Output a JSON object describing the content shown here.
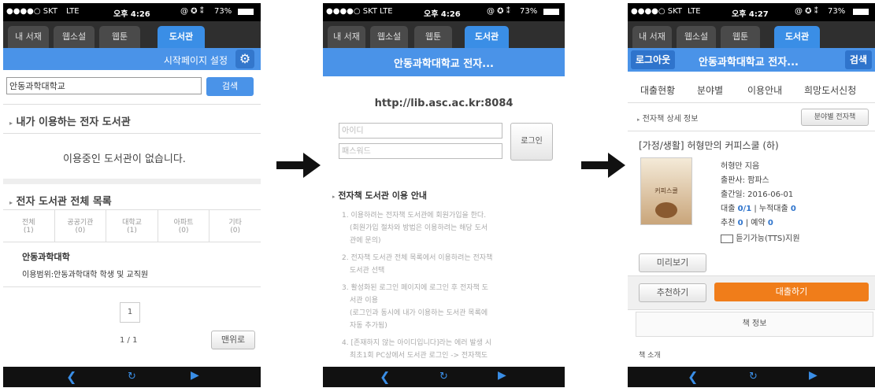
{
  "status": {
    "carrier": "●●●●○ SKT",
    "network": "LTE",
    "time1": "오후 4:26",
    "time2": "오후 4:26",
    "time3": "오후 4:27",
    "icons": "@ ✪ ⁑",
    "battery": "73%"
  },
  "tabs": [
    "내 서재",
    "웹소설",
    "웹툰",
    "도서관"
  ],
  "screen1": {
    "settings_label": "시작페이지 설정",
    "search_value": "안동과학대학교",
    "search_button": "검색",
    "my_library_heading": "내가 이용하는 전자 도서관",
    "empty_message": "이용중인 도서관이 없습니다.",
    "all_list_heading": "전자 도서관 전체 목록",
    "categories": [
      {
        "name": "전체",
        "count": "(1)"
      },
      {
        "name": "공공기관",
        "count": "(0)"
      },
      {
        "name": "대학교",
        "count": "(1)"
      },
      {
        "name": "아파트",
        "count": "(0)"
      },
      {
        "name": "기타",
        "count": "(0)"
      }
    ],
    "library_name": "안동과학대학",
    "library_scope": "이용범위:안동과학대학 학생 및 교직원",
    "page_number": "1",
    "page_indicator": "1 / 1",
    "top_button": "맨위로"
  },
  "screen2": {
    "title": "안동과학대학교 전자...",
    "url": "http://lib.asc.ac.kr:8084",
    "id_placeholder": "아이디",
    "password_placeholder": "패스워드",
    "login_button": "로그인",
    "guide_heading": "전자책 도서관 이용 안내",
    "guide_items": [
      "1. 이용하려는 전자책 도서관에 회원가입을 한다.",
      "(회원가입 절차와 방법은 이용하려는 해당 도서",
      "관에 문의)",
      "2. 전자책 도서관 전체 목록에서 이용하려는 전자책",
      "도서관 선택",
      "3. 활성화된 로그인 페이지에 로그인 후 전자책 도",
      "서관 이용",
      "(로그인과 동시에 내가 이용하는 도서관 목록에",
      "자동 추가됨)",
      "4. [존재하지 않는 아이디입니다]라는 에러 발생 시",
      "최초1회 PC상에서 도서관 로그인 -> 전자책도"
    ]
  },
  "screen3": {
    "logout_button": "로그아웃",
    "title": "안동과학대학교 전자...",
    "search_button": "검색",
    "nav": [
      "대출현황",
      "분야별",
      "이용안내",
      "희망도서신청"
    ],
    "detail_label": "전자책 상세 정보",
    "category_button": "분야별 전자책",
    "book_title": "[가정/생활] 허형만의 커피스쿨 (하)",
    "cover_text": "커피스쿨",
    "author": "허형만 지음",
    "publisher": "출판사: 팜파스",
    "published": "출간일: 2016-06-01",
    "loan_label": "대출",
    "loan_value": "0/1",
    "total_loan_label": "| 누적대출",
    "total_loan_value": "0",
    "recommend_label": "추천",
    "recommend_value": "0",
    "reserve_label": "| 예약",
    "reserve_value": "0",
    "tts_label": "듣기가능(TTS)지원",
    "preview_button": "미리보기",
    "recommend_button": "추천하기",
    "borrow_button": "대출하기",
    "book_info_tab": "책 정보",
    "book_intro": "책 소개"
  },
  "colors": {
    "accent_blue": "#4a93e8",
    "borrow_orange": "#f07d1a",
    "status_black": "#000000"
  }
}
